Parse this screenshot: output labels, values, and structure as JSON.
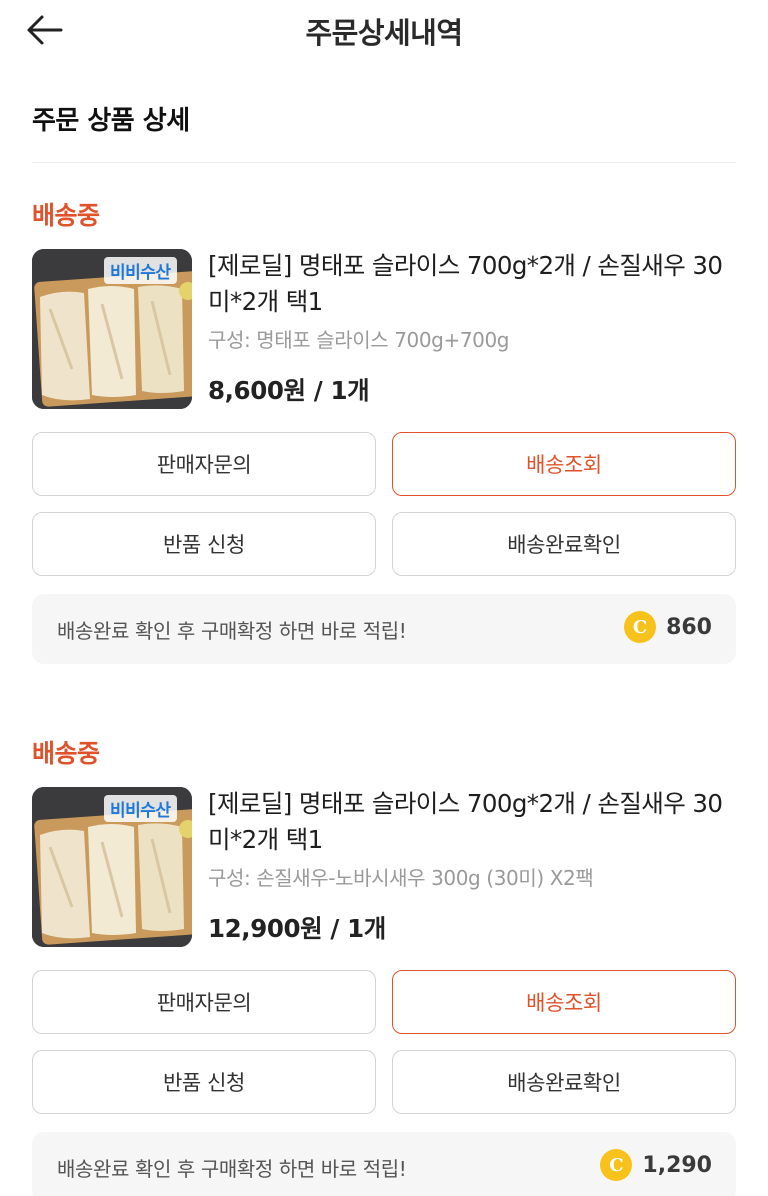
{
  "header": {
    "title": "주문상세내역",
    "back_icon": "arrow-left-icon"
  },
  "section": {
    "title": "주문 상품 상세"
  },
  "colors": {
    "accent": "#e0522a",
    "coin": "#f6c21b"
  },
  "orders": [
    {
      "status": "배송중",
      "brand": "비비수산",
      "name": "[제로딜] 명태포 슬라이스 700g*2개 / 손질새우 30미*2개 택1",
      "option": "구성: 명태포 슬라이스 700g+700g",
      "price": "8,600원 / 1개",
      "buttons": {
        "inquiry": "판매자문의",
        "track": "배송조회",
        "return": "반품 신청",
        "confirm": "배송완료확인"
      },
      "reward": {
        "text": "배송완료 확인 후 구매확정 하면 바로 적립!",
        "coin_symbol": "C",
        "amount": "860"
      }
    },
    {
      "status": "배송중",
      "brand": "비비수산",
      "name": "[제로딜] 명태포 슬라이스 700g*2개 / 손질새우 30미*2개 택1",
      "option": "구성: 손질새우-노바시새우 300g (30미) X2팩",
      "price": "12,900원 / 1개",
      "buttons": {
        "inquiry": "판매자문의",
        "track": "배송조회",
        "return": "반품 신청",
        "confirm": "배송완료확인"
      },
      "reward": {
        "text": "배송완료 확인 후 구매확정 하면 바로 적립!",
        "coin_symbol": "C",
        "amount": "1,290"
      }
    }
  ]
}
